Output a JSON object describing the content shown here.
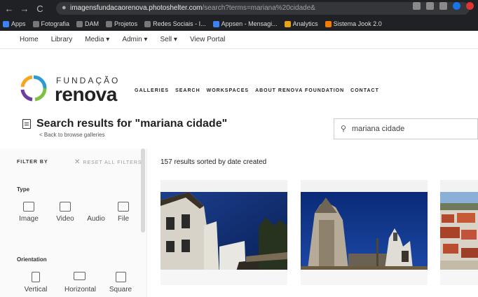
{
  "browser": {
    "nav_back": "←",
    "nav_forward": "→",
    "nav_reload": "C",
    "url_host": "imagensfundacaorenova.photoshelter.com",
    "url_path": "/search?terms=mariana%20cidade&",
    "bookmarks": [
      {
        "label": "Apps",
        "icon": "apps-icon"
      },
      {
        "label": "Fotografia",
        "icon": "bookmark-icon"
      },
      {
        "label": "DAM",
        "icon": "bookmark-icon"
      },
      {
        "label": "Projetos",
        "icon": "bookmark-icon"
      },
      {
        "label": "Redes Sociais - I...",
        "icon": "globe-icon"
      },
      {
        "label": "Appsen - Mensagi...",
        "icon": "bookmark-icon"
      },
      {
        "label": "Analytics",
        "icon": "analytics-icon"
      },
      {
        "label": "Sistema Jook 2.0",
        "icon": "bookmark-icon"
      }
    ]
  },
  "admin_bar": {
    "items": [
      "Home",
      "Library",
      "Media ▾",
      "Admin ▾",
      "Sell ▾",
      "View Portal"
    ]
  },
  "brand": {
    "line1": "FUNDAÇÃO",
    "line2": "renova"
  },
  "main_nav": [
    "GALLERIES",
    "SEARCH",
    "WORKSPACES",
    "ABOUT RENOVA FOUNDATION",
    "CONTACT"
  ],
  "search": {
    "title": "Search results for \"mariana cidade\"",
    "back_link": "< Back to browse galleries",
    "query": "mariana cidade"
  },
  "sidebar": {
    "filter_by": "FILTER BY",
    "reset_filters": "RESET ALL FILTERS",
    "type_label": "Type",
    "type_options": [
      "Image",
      "Video",
      "Audio",
      "File"
    ],
    "orientation_label": "Orientation",
    "orientation_options": [
      "Vertical",
      "Horizontal",
      "Square"
    ]
  },
  "results": {
    "count_text": "157 results sorted by date created"
  },
  "colors": {
    "chrome_bg": "#202124",
    "sky_blue": "#0b2a6b",
    "brand_text": "#222222"
  }
}
